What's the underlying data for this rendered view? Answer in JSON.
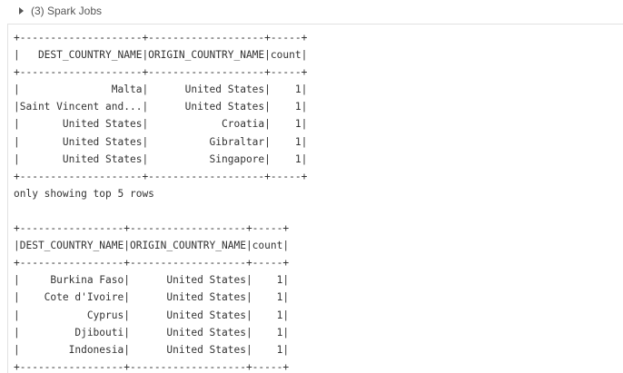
{
  "header": {
    "spark_jobs_label": "(3) Spark Jobs"
  },
  "output": {
    "text": "+--------------------+-------------------+-----+\n|   DEST_COUNTRY_NAME|ORIGIN_COUNTRY_NAME|count|\n+--------------------+-------------------+-----+\n|               Malta|      United States|    1|\n|Saint Vincent and...|      United States|    1|\n|       United States|            Croatia|    1|\n|       United States|          Gibraltar|    1|\n|       United States|          Singapore|    1|\n+--------------------+-------------------+-----+\nonly showing top 5 rows\n\n+-----------------+-------------------+-----+\n|DEST_COUNTRY_NAME|ORIGIN_COUNTRY_NAME|count|\n+-----------------+-------------------+-----+\n|     Burkina Faso|      United States|    1|\n|    Cote d'Ivoire|      United States|    1|\n|           Cyprus|      United States|    1|\n|         Djibouti|      United States|    1|\n|        Indonesia|      United States|    1|\n+-----------------+-------------------+-----+"
  }
}
